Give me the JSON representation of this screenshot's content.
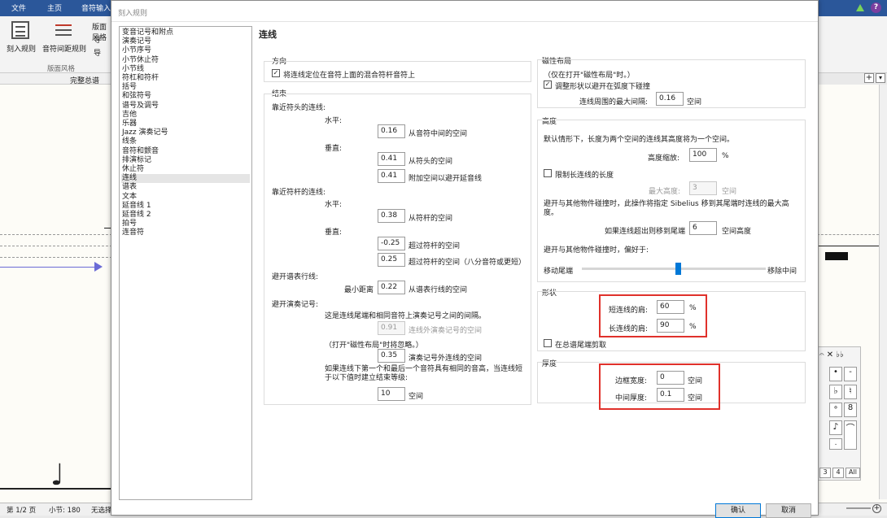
{
  "app": {
    "ribbon_tabs": [
      "文件",
      "主页",
      "音符输入"
    ],
    "ribbon_buttons": [
      "刻入规则",
      "音符间距规则",
      "版面风格"
    ],
    "ribbon_small": [
      "导",
      "导"
    ],
    "ribbon_group_label": "版面风格",
    "view_label": "完整总谱",
    "status": [
      "第 1/2 页",
      "小节: 180",
      "无选择"
    ],
    "keypad": [
      "3",
      "4",
      "All"
    ]
  },
  "dialog": {
    "title": "刻入规则",
    "categories": [
      "变音记号和附点",
      "演奏记号",
      "小节序号",
      "小节休止符",
      "小节线",
      "符杠和符杆",
      "括号",
      "和弦符号",
      "谱号及调号",
      "吉他",
      "乐器",
      "Jazz 演奏记号",
      "线条",
      "音符和颤音",
      "排演标记",
      "休止符",
      "连线",
      "谱表",
      "文本",
      "延音线 1",
      "延音线 2",
      "拍号",
      "连音符"
    ],
    "selected_category": "连线",
    "panel_title": "连线",
    "direction": {
      "title": "方向",
      "checkbox_label": "将连线定位在音符上面的混合符杆音符上",
      "checked": true
    },
    "ends": {
      "title": "结束",
      "near_notehead": "靠近符头的连线:",
      "horizontal": "水平:",
      "vertical": "垂直:",
      "nh_h_value": "0.16",
      "nh_h_label": "从音符中间的空间",
      "nh_v1_value": "0.41",
      "nh_v1_label": "从符头的空间",
      "nh_v2_value": "0.41",
      "nh_v2_label": "附加空间以避开延音线",
      "near_stem": "靠近符杆的连线:",
      "st_h_value": "0.38",
      "st_h_label": "从符杆的空间",
      "st_v1_value": "-0.25",
      "st_v1_label": "超过符杆的空间",
      "st_v2_value": "0.25",
      "st_v2_label": "超过符杆的空间（八分音符或更短）",
      "avoid_staff": "避开谱表行线:",
      "min_dist_label": "最小距离",
      "min_dist_value": "0.22",
      "min_dist_unit": "从谱表行线的空间",
      "avoid_art": "避开演奏记号:",
      "art_desc": "这是连线尾端和相同音符上演奏记号之间的间隔。",
      "art_out_value": "0.91",
      "art_out_label": "连线外演奏记号的空间",
      "art_note": "（打开\"磁性布局\"时将忽略。）",
      "art_in_value": "0.35",
      "art_in_label": "演奏记号外连线的空间",
      "pitch_desc": "如果连线下第一个和最后一个音符具有相同的音高，当连线短于以下值时建立结束等级:",
      "pitch_value": "10",
      "pitch_unit": "空间"
    },
    "magnetic": {
      "title": "磁性布局",
      "note": "（仅在打开\"磁性布局\"时。）",
      "checkbox_label": "调整形状以避开在弧度下碰撞",
      "checked": true,
      "max_gap_label": "连线周围的最大间隔:",
      "max_gap_value": "0.16",
      "max_gap_unit": "空间"
    },
    "height": {
      "title": "高度",
      "desc": "默认情形下，长度为两个空间的连线其高度将为一个空间。",
      "scale_label": "高度缩放:",
      "scale_value": "100",
      "scale_unit": "%",
      "limit_label": "限制长连线的长度",
      "limit_checked": false,
      "max_height_label": "最大高度:",
      "max_height_value": "3",
      "max_height_unit": "空间",
      "avoid_desc": "避开与其他物件碰撞时，此操作将指定 Sibelius 移到其尾端时连线的最大高度。",
      "move_label": "如果连线超出则移到尾端",
      "move_value": "6",
      "move_unit": "空间高度",
      "prefer_desc": "避开与其他物件碰撞时，偏好于:",
      "slider_left": "移动尾端",
      "slider_right": "移除中间",
      "slider_value": 0.52
    },
    "shape": {
      "title": "形状",
      "short_label": "短连线的肩:",
      "short_value": "60",
      "short_unit": "%",
      "long_label": "长连线的肩:",
      "long_value": "90",
      "long_unit": "%",
      "clip_label": "在总谱尾端剪取",
      "clip_checked": false
    },
    "thickness": {
      "title": "厚度",
      "edge_label": "边框宽度:",
      "edge_value": "0",
      "edge_unit": "空间",
      "mid_label": "中间厚度:",
      "mid_value": "0.1",
      "mid_unit": "空间"
    },
    "ok": "确认",
    "cancel": "取消"
  },
  "colors": {
    "ribbon": "#2b579a",
    "highlight": "#e0312b",
    "slider": "#0078d7"
  }
}
